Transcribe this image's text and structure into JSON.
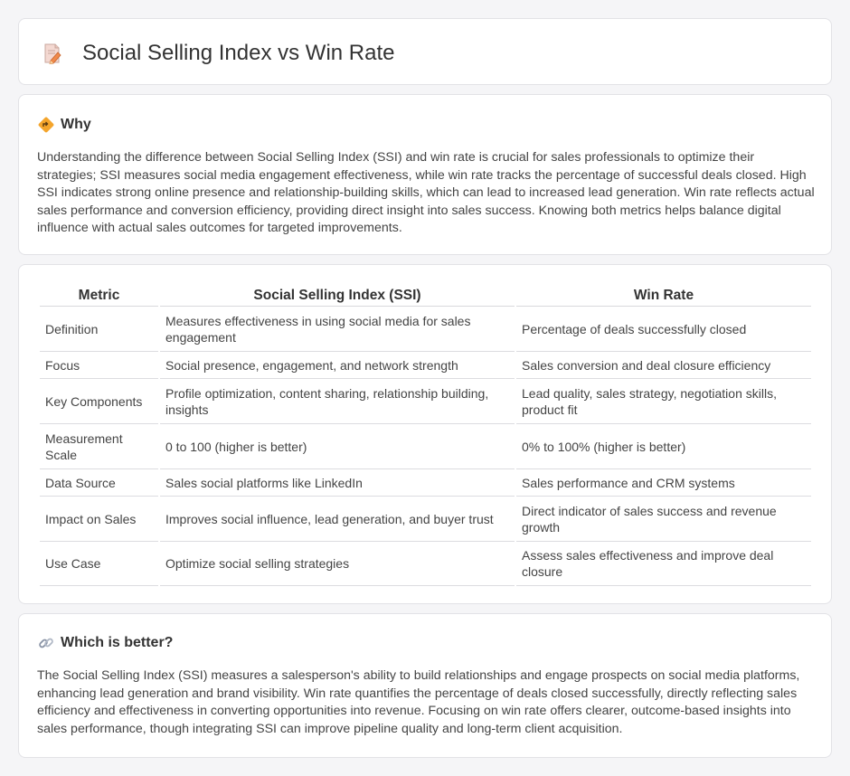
{
  "header": {
    "title": "Social Selling Index vs Win Rate",
    "icon": "document-pencil-icon"
  },
  "why": {
    "title": "Why",
    "icon": "diamond-direction-icon",
    "text": "Understanding the difference between Social Selling Index (SSI) and win rate is crucial for sales professionals to optimize their strategies; SSI measures social media engagement effectiveness, while win rate tracks the percentage of successful deals closed. High SSI indicates strong online presence and relationship-building skills, which can lead to increased lead generation. Win rate reflects actual sales performance and conversion efficiency, providing direct insight into sales success. Knowing both metrics helps balance digital influence with actual sales outcomes for targeted improvements."
  },
  "table": {
    "headers": [
      "Metric",
      "Social Selling Index (SSI)",
      "Win Rate"
    ],
    "rows": [
      [
        "Definition",
        "Measures effectiveness in using social media for sales engagement",
        "Percentage of deals successfully closed"
      ],
      [
        "Focus",
        "Social presence, engagement, and network strength",
        "Sales conversion and deal closure efficiency"
      ],
      [
        "Key Components",
        "Profile optimization, content sharing, relationship building, insights",
        "Lead quality, sales strategy, negotiation skills, product fit"
      ],
      [
        "Measurement Scale",
        "0 to 100 (higher is better)",
        "0% to 100% (higher is better)"
      ],
      [
        "Data Source",
        "Sales social platforms like LinkedIn",
        "Sales performance and CRM systems"
      ],
      [
        "Impact on Sales",
        "Improves social influence, lead generation, and buyer trust",
        "Direct indicator of sales success and revenue growth"
      ],
      [
        "Use Case",
        "Optimize social selling strategies",
        "Assess sales effectiveness and improve deal closure"
      ]
    ]
  },
  "better": {
    "title": "Which is better?",
    "icon": "link-icon",
    "text": "The Social Selling Index (SSI) measures a salesperson's ability to build relationships and engage prospects on social media platforms, enhancing lead generation and brand visibility. Win rate quantifies the percentage of deals closed successfully, directly reflecting sales efficiency and effectiveness in converting opportunities into revenue. Focusing on win rate offers clearer, outcome-based insights into sales performance, though integrating SSI can improve pipeline quality and long-term client acquisition."
  },
  "colors": {
    "background": "#f5f5f7",
    "card": "#ffffff",
    "border": "#e2e2e6",
    "icon_orange": "#f0a030",
    "icon_pink": "#e86a7a"
  }
}
